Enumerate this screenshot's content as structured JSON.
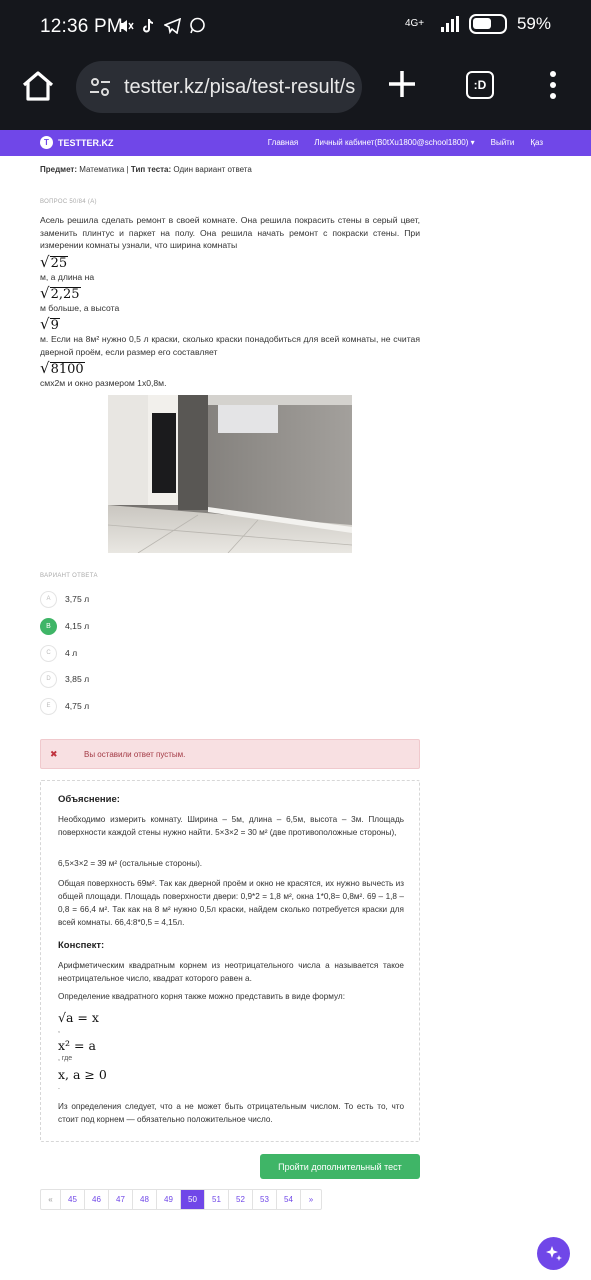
{
  "status_bar": {
    "time": "12:36 PM",
    "network": "4G+",
    "battery": "59%"
  },
  "browser": {
    "url": "testter.kz/pisa/test-result/s"
  },
  "site": {
    "logo": "TESTTER.KZ",
    "logo_mark": "T",
    "nav": [
      "Главная",
      "Личный кабинет(B0tXu1800@school1800) ▾",
      "Выйти",
      "Қаз"
    ]
  },
  "meta": {
    "subject_label": "Предмет:",
    "subject": "Математика",
    "type_label": "Тип теста:",
    "type": "Один вариант ответа"
  },
  "question": {
    "number": "ВОПРОС 50/84 (A)",
    "intro": "Асель решила сделать ремонт в своей комнате. Она решила покрасить стены в серый цвет, заменить плинтус и паркет на полу.  Она решила начать ремонт с покраски стены. При измерении комнаты узнали, что ширина комнаты",
    "sqrt1": "25",
    "text2": "м, а длина на",
    "sqrt2": "2,25",
    "text3": "м больше, а высота",
    "sqrt3": "9",
    "text4": "м. Если на 8м² нужно 0,5 л краски, сколько краски понадобиться для всей комнаты, не считая дверной проём, если размер его составляет",
    "sqrt4": "8100",
    "text5": "смх2м и окно размером 1х0,8м."
  },
  "answers": {
    "label": "ВАРИАНТ ОТВЕТА",
    "options": [
      {
        "letter": "A",
        "text": "3,75 л",
        "correct": false
      },
      {
        "letter": "B",
        "text": "4,15 л",
        "correct": true
      },
      {
        "letter": "C",
        "text": "4 л",
        "correct": false
      },
      {
        "letter": "D",
        "text": "3,85 л",
        "correct": false
      },
      {
        "letter": "E",
        "text": "4,75 л",
        "correct": false
      }
    ]
  },
  "alert": {
    "icon": "✖",
    "message": "Вы оставили ответ пустым."
  },
  "explanation": {
    "title": "Объяснение:",
    "p1": "Необходимо измерить комнату. Ширина – 5м, длина – 6,5м, высота – 3м. Площадь поверхности каждой стены нужно найти. 5×3×2 = 30 м² (две противоположные стороны),",
    "p2": "6,5×3×2 = 39 м² (остальные стороны).",
    "p3": "Общая поверхность 69м². Так как дверной проём и окно не красятся, их нужно вычесть из общей  площади. Площадь поверхности двери: 0,9*2 = 1,8 м², окна 1*0,8= 0,8м². 69 – 1,8 – 0,8 = 66,4 м². Так как на 8 м² нужно 0,5л краски, найдем сколько потребуется краски для всей комнаты. 66,4:8*0,5 = 4,15л.",
    "summary_title": "Конспект:",
    "s1": "Арифметическим квадратным корнем из неотрицательного числа a называется такое неотрицательное число, квадрат которого равен a.",
    "s2": "Определение квадратного корня также можно представить в виде формул:",
    "f1": "√a = x",
    "comma1": ",",
    "f2": "x² = a",
    "where": ", где",
    "f3": "x, a ≥ 0",
    "dot": ".",
    "s3": "Из определения следует, что a не может быть отрицательным числом. То есть то, что стоит под корнем — обязательно положительное число."
  },
  "more_button": "Пройти дополнительный тест",
  "pagination": {
    "prev": "«",
    "pages": [
      "45",
      "46",
      "47",
      "48",
      "49",
      "50",
      "51",
      "52",
      "53",
      "54"
    ],
    "active": "50",
    "next": "»"
  }
}
